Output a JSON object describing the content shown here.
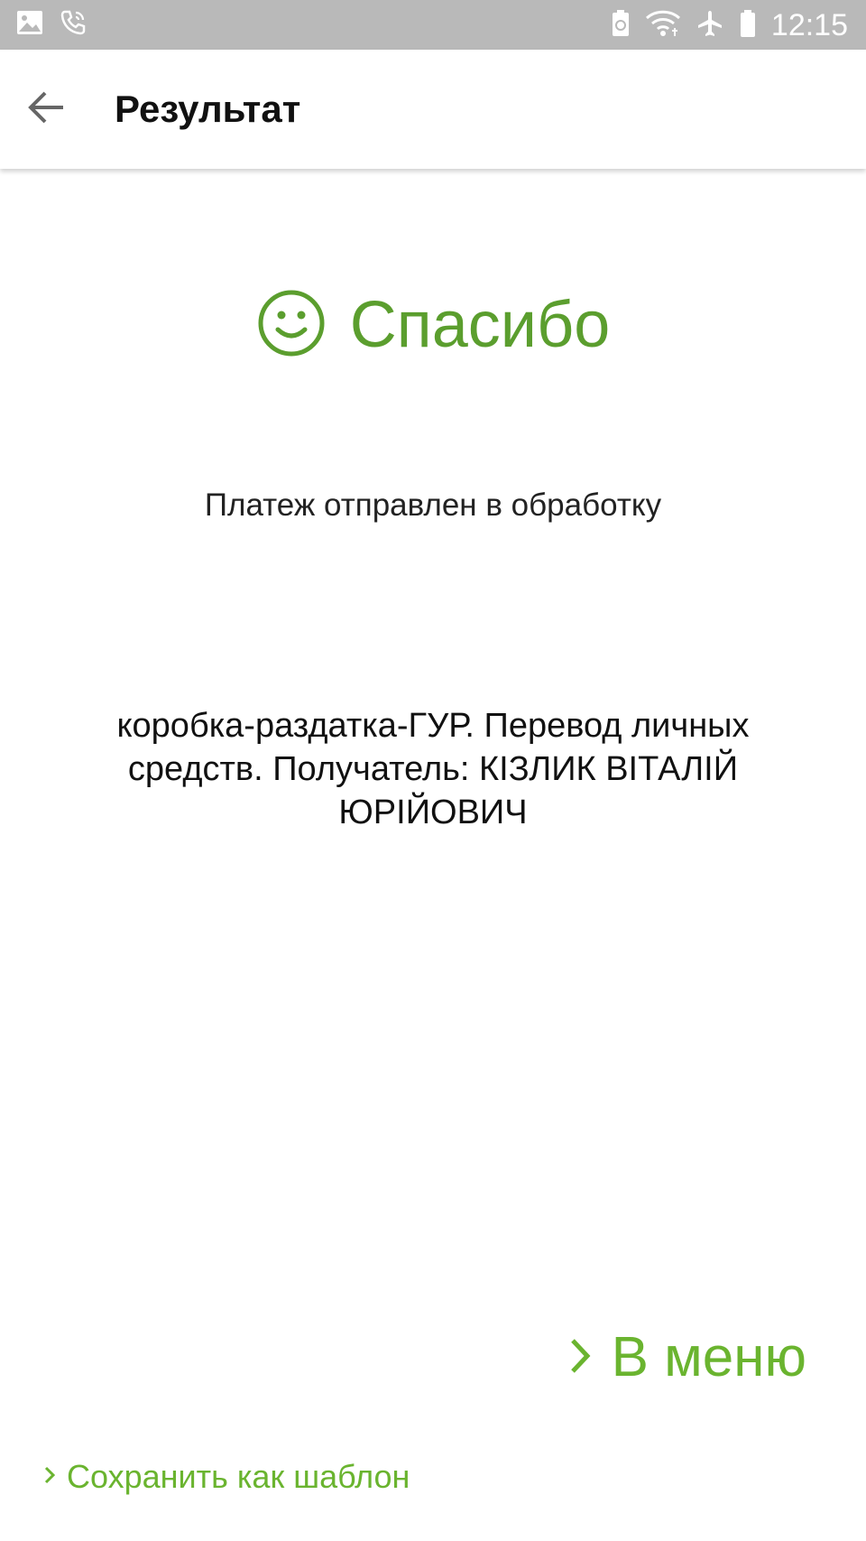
{
  "status_bar": {
    "time": "12:15",
    "icons": [
      "image-icon",
      "phone-call-icon",
      "battery-saver-icon",
      "wifi-icon",
      "airplane-icon",
      "battery-icon"
    ]
  },
  "app_bar": {
    "title": "Результат",
    "back_icon": "arrow-back-icon"
  },
  "result": {
    "thanks_label": "Спасибо",
    "smiley_icon": "smiley-icon",
    "status_message": "Платеж отправлен в обработку",
    "details": "коробка-раздатка-ГУР. Перевод личных средств. Получатель: КІЗЛИК ВІТАЛІЙ ЮРІЙОВИЧ"
  },
  "actions": {
    "menu_label": "В меню",
    "save_template_label": "Сохранить как шаблон"
  },
  "colors": {
    "status_bar": "#b9b9b9",
    "thanks_green": "#5b9e2e",
    "action_green": "#6ab42f"
  }
}
